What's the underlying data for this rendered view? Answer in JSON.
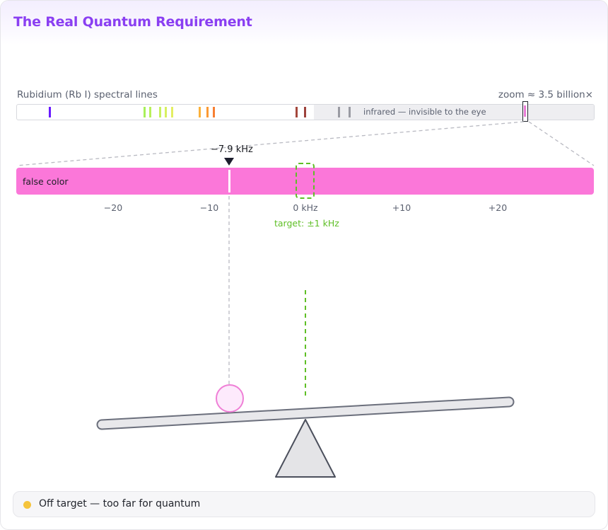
{
  "header": {
    "title": "The Real Quantum Requirement"
  },
  "spectrum": {
    "label": "Rubidium (Rb I) spectral lines",
    "zoom_label": "zoom ≈ 3.5 billion×",
    "infrared_label": "infrared — invisible to the eye",
    "visible_lines": [
      {
        "pos": 0.055,
        "color": "#6a1bff"
      },
      {
        "pos": 0.219,
        "color": "#a8f05a"
      },
      {
        "pos": 0.229,
        "color": "#b9f05a"
      },
      {
        "pos": 0.246,
        "color": "#c8f060"
      },
      {
        "pos": 0.256,
        "color": "#d7f060"
      },
      {
        "pos": 0.267,
        "color": "#e3ee62"
      },
      {
        "pos": 0.315,
        "color": "#fbb13a"
      },
      {
        "pos": 0.328,
        "color": "#fb9a35"
      },
      {
        "pos": 0.34,
        "color": "#f77f32"
      },
      {
        "pos": 0.483,
        "color": "#a4473c"
      },
      {
        "pos": 0.497,
        "color": "#9d423c"
      },
      {
        "pos": 0.556,
        "color": "#9a9ba3"
      },
      {
        "pos": 0.575,
        "color": "#9a9ba3"
      }
    ],
    "zoom_position": 0.881,
    "focus_color": "#fb77d9"
  },
  "zoom_view": {
    "false_color_label": "false color",
    "marker_value": "−7.9 kHz",
    "marker_khz": -7.9,
    "target_label": "target: ±1 kHz",
    "target_tolerance_khz": 1,
    "range_khz": [
      -30,
      30
    ],
    "ticks": [
      {
        "value": -20,
        "label": "−20"
      },
      {
        "value": -10,
        "label": "−10"
      },
      {
        "value": 0,
        "label": "0 kHz"
      },
      {
        "value": 10,
        "label": "+10"
      },
      {
        "value": 20,
        "label": "+20"
      }
    ]
  },
  "status": {
    "text": "Off target — too far for quantum",
    "dot_color": "#f5c43c"
  }
}
